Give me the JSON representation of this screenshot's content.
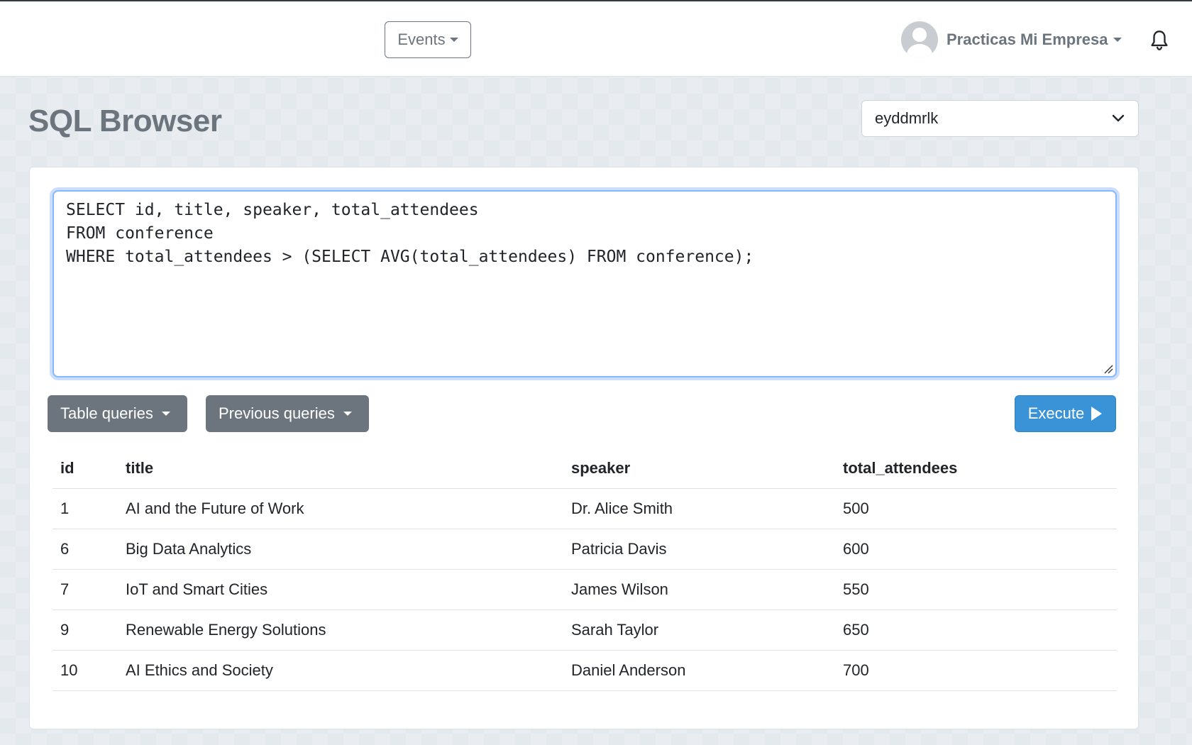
{
  "topbar": {
    "events_label": "Events",
    "user_name": "Practicas Mi Empresa",
    "bell_icon": "bell-icon",
    "avatar_icon": "user-avatar-icon"
  },
  "page": {
    "title": "SQL Browser",
    "database_selected": "eyddmrlk"
  },
  "editor": {
    "query": "SELECT id, title, speaker, total_attendees\nFROM conference\nWHERE total_attendees > (SELECT AVG(total_attendees) FROM conference);"
  },
  "buttons": {
    "table_queries": "Table queries",
    "previous_queries": "Previous queries",
    "execute": "Execute"
  },
  "results": {
    "columns": [
      "id",
      "title",
      "speaker",
      "total_attendees"
    ],
    "rows": [
      [
        "1",
        "AI and the Future of Work",
        "Dr. Alice Smith",
        "500"
      ],
      [
        "6",
        "Big Data Analytics",
        "Patricia Davis",
        "600"
      ],
      [
        "7",
        "IoT and Smart Cities",
        "James Wilson",
        "550"
      ],
      [
        "9",
        "Renewable Energy Solutions",
        "Sarah Taylor",
        "650"
      ],
      [
        "10",
        "AI Ethics and Society",
        "Daniel Anderson",
        "700"
      ]
    ]
  },
  "colors": {
    "primary": "#3a93d6",
    "secondary": "#6c757d",
    "focus_border": "#86b7fe",
    "page_background": "#e4e9ee"
  }
}
